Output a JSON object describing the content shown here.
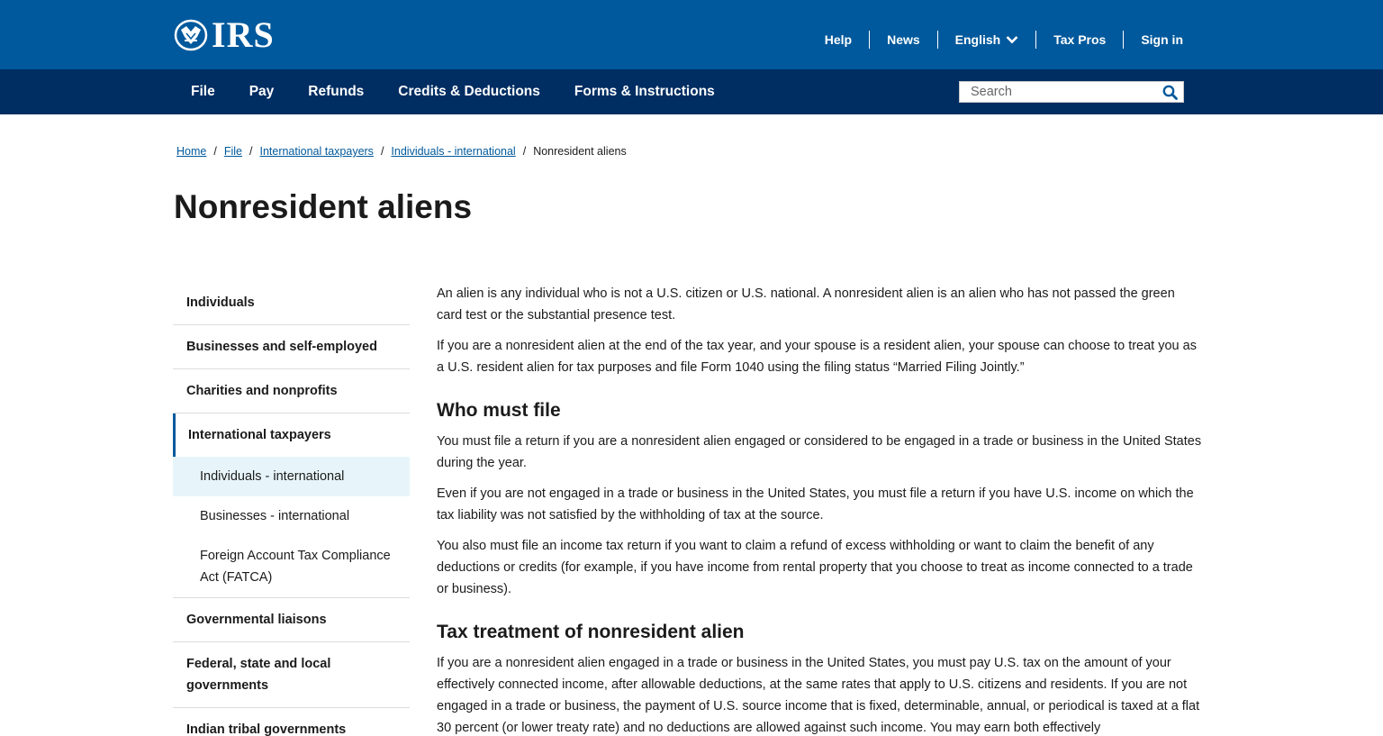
{
  "header": {
    "logo_text": "IRS",
    "utility": [
      "Help",
      "News",
      "English",
      "Tax Pros",
      "Sign in"
    ]
  },
  "nav": {
    "items": [
      "File",
      "Pay",
      "Refunds",
      "Credits & Deductions",
      "Forms & Instructions"
    ],
    "search_placeholder": "Search"
  },
  "breadcrumb": {
    "links": [
      "Home",
      "File",
      "International taxpayers",
      "Individuals - international"
    ],
    "current": "Nonresident aliens"
  },
  "page_title": "Nonresident aliens",
  "sidebar": {
    "items": [
      "Individuals",
      "Businesses and self-employed",
      "Charities and nonprofits",
      "International taxpayers"
    ],
    "subitems": [
      "Individuals - international",
      "Businesses - international",
      "Foreign Account Tax Compliance Act (FATCA)"
    ],
    "items_after": [
      "Governmental liaisons",
      "Federal, state and local governments",
      "Indian tribal governments"
    ]
  },
  "content": {
    "intro": [
      "An alien is any individual who is not a U.S. citizen or U.S. national. A nonresident alien is an alien who has not passed the green card test or the substantial presence test.",
      "If you are a nonresident alien at the end of the tax year, and your spouse is a resident alien, your spouse can choose to treat you as a U.S. resident alien for tax purposes and file Form 1040 using the filing status “Married Filing Jointly.”"
    ],
    "h_who": "Who must file",
    "who": [
      "You must file a return if you are a nonresident alien engaged or considered to be engaged in a trade or business in the United States during the year.",
      "Even if you are not engaged in a trade or business in the United States, you must file a return if you have U.S. income on which the tax liability was not satisfied by the withholding of tax at the source.",
      "You also must file an income tax return if you want to claim a refund of excess withholding or want to claim the benefit of any deductions or credits (for example, if you have income from rental property that you choose to treat as income connected to a trade or business)."
    ],
    "h_tax": "Tax treatment of nonresident alien",
    "tax": [
      "If you are a nonresident alien engaged in a trade or business in the United States, you must pay U.S. tax on the amount of your effectively connected income, after allowable deductions, at the same rates that apply to U.S. citizens and residents. If you are not engaged in a trade or business, the payment of U.S. source income that is fixed, determinable, annual, or periodical is taxed at a flat 30 percent (or lower treaty rate) and no deductions are allowed against such income. You may earn both effectively"
    ]
  },
  "colors": {
    "header_blue": "#00599c",
    "nav_navy": "#002d62",
    "link": "#00599c",
    "selected_bg": "#e7f5fa"
  }
}
